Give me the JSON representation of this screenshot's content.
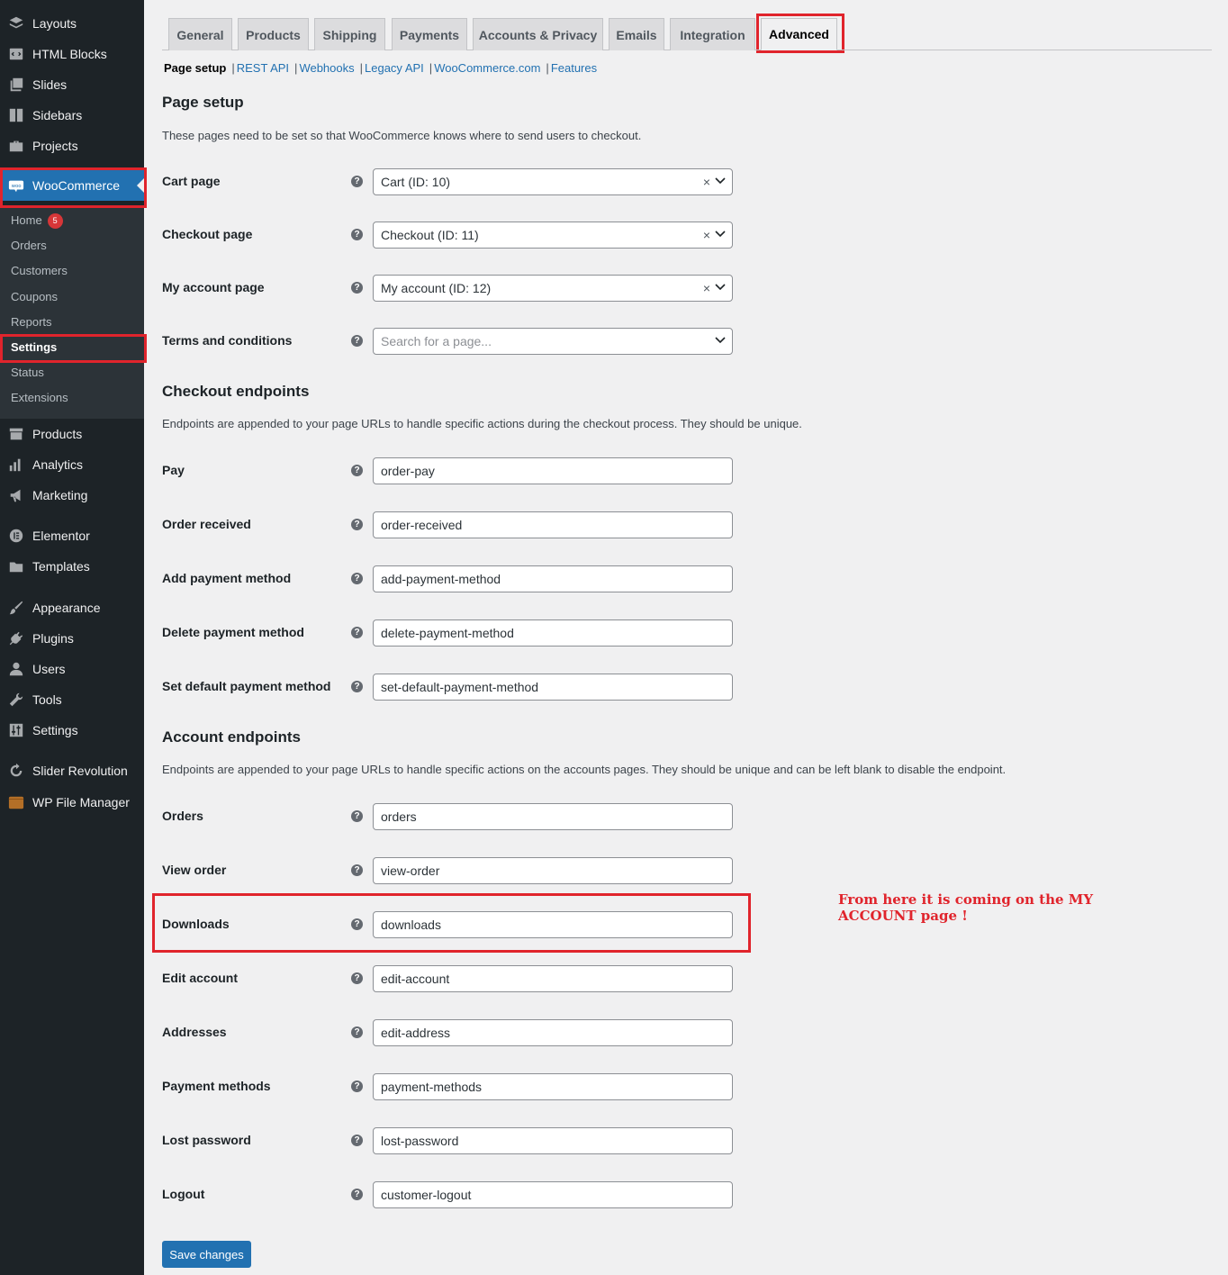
{
  "sidebar": {
    "top_items": [
      {
        "label": "Layouts",
        "icon": "layers-icon"
      },
      {
        "label": "HTML Blocks",
        "icon": "code-block-icon"
      },
      {
        "label": "Slides",
        "icon": "slides-icon"
      },
      {
        "label": "Sidebars",
        "icon": "sidebar-icon"
      },
      {
        "label": "Projects",
        "icon": "briefcase-icon"
      }
    ],
    "woocommerce": {
      "label": "WooCommerce",
      "icon": "woo-icon"
    },
    "woo_sub": [
      {
        "label": "Home",
        "badge": "5"
      },
      {
        "label": "Orders"
      },
      {
        "label": "Customers"
      },
      {
        "label": "Coupons"
      },
      {
        "label": "Reports"
      },
      {
        "label": "Settings"
      },
      {
        "label": "Status"
      },
      {
        "label": "Extensions"
      }
    ],
    "bottom_items": [
      {
        "label": "Products",
        "icon": "archive-icon"
      },
      {
        "label": "Analytics",
        "icon": "bar-chart-icon"
      },
      {
        "label": "Marketing",
        "icon": "megaphone-icon"
      },
      {
        "label": "Elementor",
        "icon": "elementor-icon"
      },
      {
        "label": "Templates",
        "icon": "folder-icon"
      },
      {
        "label": "Appearance",
        "icon": "paintbrush-icon"
      },
      {
        "label": "Plugins",
        "icon": "plug-icon"
      },
      {
        "label": "Users",
        "icon": "user-icon"
      },
      {
        "label": "Tools",
        "icon": "wrench-icon"
      },
      {
        "label": "Settings",
        "icon": "sliders-icon"
      },
      {
        "label": "Slider Revolution",
        "icon": "refresh-icon"
      },
      {
        "label": "WP File Manager",
        "icon": "file-manager-icon"
      }
    ]
  },
  "tabs": [
    "General",
    "Products",
    "Shipping",
    "Payments",
    "Accounts & Privacy",
    "Emails",
    "Integration",
    "Advanced"
  ],
  "subnav": [
    "Page setup",
    "REST API",
    "Webhooks",
    "Legacy API",
    "WooCommerce.com",
    "Features"
  ],
  "page_setup": {
    "title": "Page setup",
    "description": "These pages need to be set so that WooCommerce knows where to send users to checkout.",
    "rows": [
      {
        "label": "Cart page",
        "value": "Cart (ID: 10)"
      },
      {
        "label": "Checkout page",
        "value": "Checkout (ID: 11)"
      },
      {
        "label": "My account page",
        "value": "My account (ID: 12)"
      },
      {
        "label": "Terms and conditions",
        "placeholder": "Search for a page..."
      }
    ]
  },
  "checkout_endpoints": {
    "title": "Checkout endpoints",
    "description": "Endpoints are appended to your page URLs to handle specific actions during the checkout process. They should be unique.",
    "rows": [
      {
        "label": "Pay",
        "value": "order-pay"
      },
      {
        "label": "Order received",
        "value": "order-received"
      },
      {
        "label": "Add payment method",
        "value": "add-payment-method"
      },
      {
        "label": "Delete payment method",
        "value": "delete-payment-method"
      },
      {
        "label": "Set default payment method",
        "value": "set-default-payment-method"
      }
    ]
  },
  "account_endpoints": {
    "title": "Account endpoints",
    "description": "Endpoints are appended to your page URLs to handle specific actions on the accounts pages. They should be unique and can be left blank to disable the endpoint.",
    "rows": [
      {
        "label": "Orders",
        "value": "orders"
      },
      {
        "label": "View order",
        "value": "view-order"
      },
      {
        "label": "Downloads",
        "value": "downloads"
      },
      {
        "label": "Edit account",
        "value": "edit-account"
      },
      {
        "label": "Addresses",
        "value": "edit-address"
      },
      {
        "label": "Payment methods",
        "value": "payment-methods"
      },
      {
        "label": "Lost password",
        "value": "lost-password"
      },
      {
        "label": "Logout",
        "value": "customer-logout"
      }
    ]
  },
  "annotation": "From here it is coming on the MY ACCOUNT page !",
  "save_label": "Save changes",
  "help_glyph": "?",
  "clear_glyph": "×",
  "colors": {
    "sidebar_bg": "#1d2327",
    "accent": "#2271b1",
    "highlight": "#e0242c",
    "badge": "#d63638"
  }
}
